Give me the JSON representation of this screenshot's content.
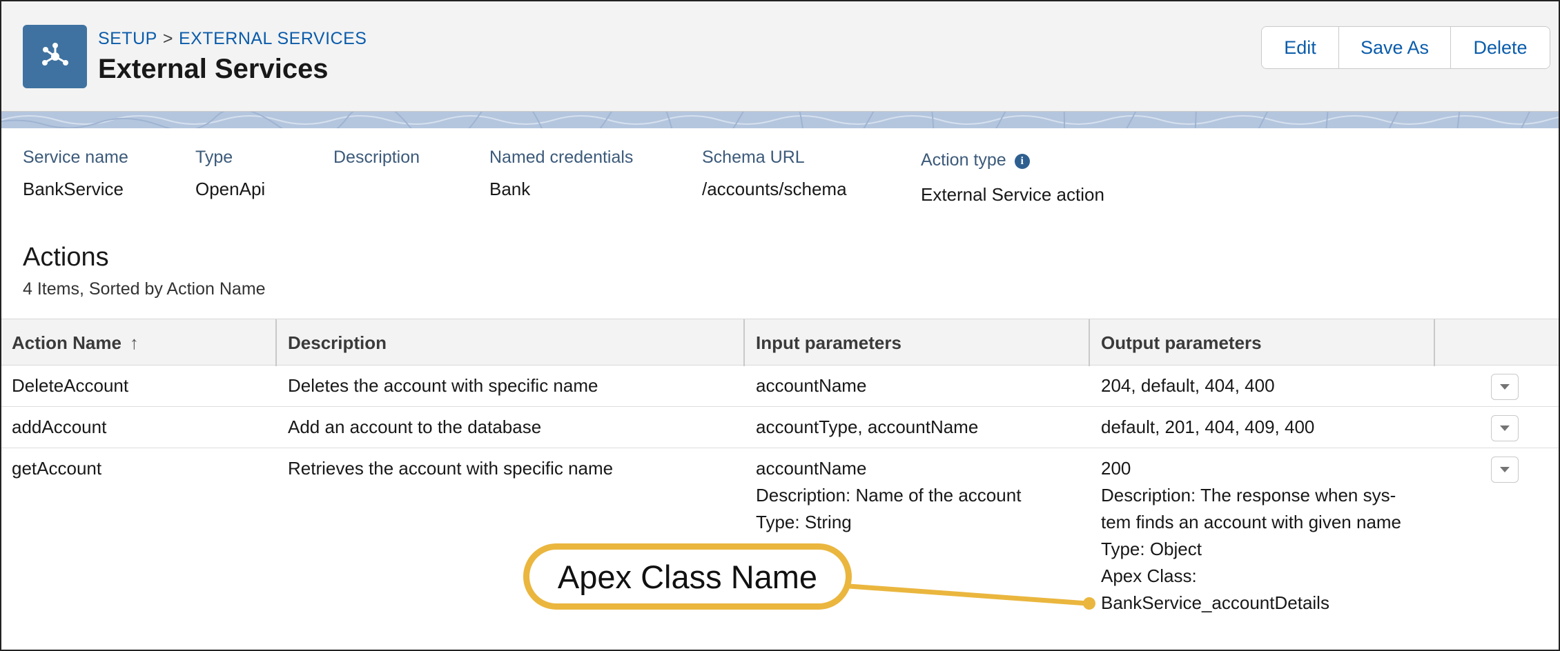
{
  "breadcrumb": {
    "setup": "SETUP",
    "separator": ">",
    "current": "EXTERNAL SERVICES"
  },
  "page": {
    "title": "External Services",
    "icon": "external-services-icon"
  },
  "buttons": {
    "edit": "Edit",
    "save_as": "Save As",
    "delete": "Delete"
  },
  "details": {
    "service_name_label": "Service name",
    "service_name": "BankService",
    "type_label": "Type",
    "type": "OpenApi",
    "description_label": "Description",
    "description": "",
    "named_credentials_label": "Named credentials",
    "named_credentials": "Bank",
    "schema_url_label": "Schema URL",
    "schema_url": "/accounts/schema",
    "action_type_label": "Action type",
    "action_type": "External Service action"
  },
  "actions": {
    "title": "Actions",
    "subtitle": "4 Items, Sorted by Action Name",
    "columns": {
      "name": "Action Name",
      "description": "Description",
      "input": "Input parameters",
      "output": "Output parameters"
    },
    "rows": [
      {
        "name": "DeleteAccount",
        "description": "Deletes the account with specific name",
        "input": [
          "accountName"
        ],
        "output": [
          "204, default, 404, 400"
        ]
      },
      {
        "name": "addAccount",
        "description": "Add an account to the database",
        "input": [
          "accountType, accountName"
        ],
        "output": [
          "default, 201, 404, 409, 400"
        ]
      },
      {
        "name": "getAccount",
        "description": "Retrieves the account with specific name",
        "input": [
          "accountName",
          "Description: Name of the account",
          "Type: String"
        ],
        "output": [
          "200",
          "Description: The response when sys-",
          "tem finds an account with given name",
          "Type: Object",
          "Apex Class:",
          "BankService_accountDetails"
        ]
      }
    ]
  },
  "callout": {
    "label": "Apex Class Name",
    "color": "#eab63e"
  },
  "colors": {
    "brand": "#3f72a0",
    "link": "#0b5cab",
    "header_bg": "#f3f3f3"
  }
}
